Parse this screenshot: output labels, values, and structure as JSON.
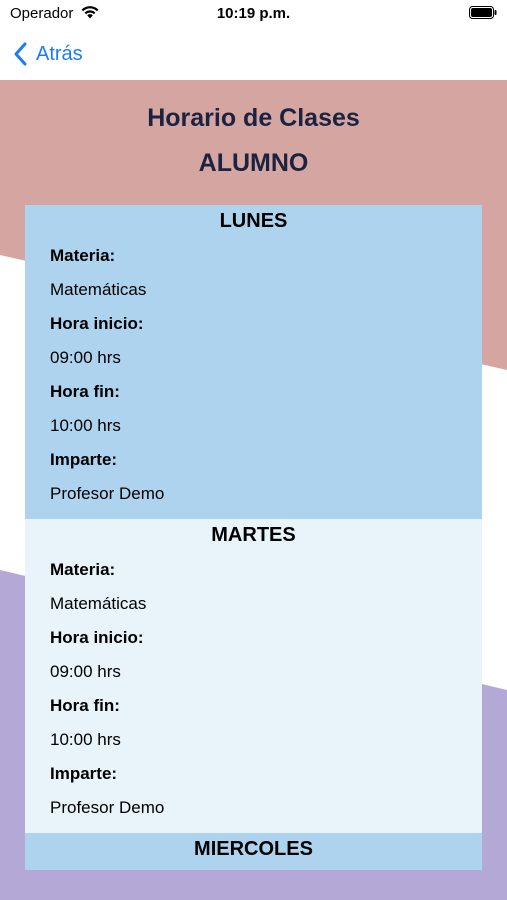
{
  "status_bar": {
    "carrier": "Operador",
    "time": "10:19 p.m."
  },
  "nav": {
    "back_label": "Atrás"
  },
  "header": {
    "title": "Horario de Clases",
    "subtitle": "ALUMNO"
  },
  "days": [
    {
      "name": "LUNES",
      "materia_label": "Materia:",
      "materia": "Matemáticas",
      "inicio_label": "Hora inicio:",
      "inicio": "09:00 hrs",
      "fin_label": "Hora fin:",
      "fin": "10:00 hrs",
      "imparte_label": "Imparte:",
      "imparte": "Profesor Demo"
    },
    {
      "name": "MARTES",
      "materia_label": "Materia:",
      "materia": "Matemáticas",
      "inicio_label": "Hora inicio:",
      "inicio": "09:00 hrs",
      "fin_label": "Hora fin:",
      "fin": "10:00 hrs",
      "imparte_label": "Imparte:",
      "imparte": "Profesor Demo"
    },
    {
      "name": "MIERCOLES"
    }
  ],
  "colors": {
    "accent": "#1a7cf5",
    "card_blue": "#add3ef",
    "card_light": "#e8f3fa",
    "bg_rose": "#d4a5a1",
    "bg_lavender": "#b3a8d6"
  }
}
